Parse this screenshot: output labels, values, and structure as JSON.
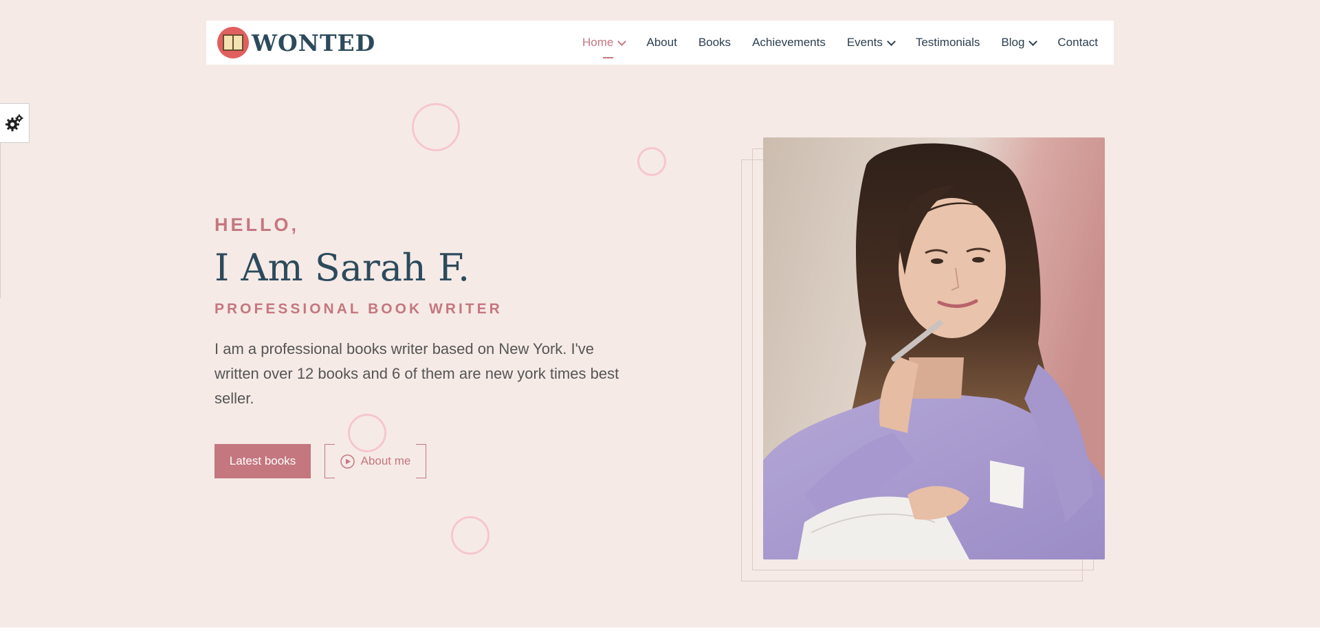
{
  "brand": {
    "name": "WONTED",
    "accent_color": "#c4777f",
    "navy_color": "#2c4a5c",
    "background_color": "#f5eae6"
  },
  "nav": {
    "items": [
      {
        "label": "Home",
        "has_dropdown": true,
        "active": true
      },
      {
        "label": "About",
        "has_dropdown": false,
        "active": false
      },
      {
        "label": "Books",
        "has_dropdown": false,
        "active": false
      },
      {
        "label": "Achievements",
        "has_dropdown": false,
        "active": false
      },
      {
        "label": "Events",
        "has_dropdown": true,
        "active": false
      },
      {
        "label": "Testimonials",
        "has_dropdown": false,
        "active": false
      },
      {
        "label": "Blog",
        "has_dropdown": true,
        "active": false
      },
      {
        "label": "Contact",
        "has_dropdown": false,
        "active": false
      }
    ]
  },
  "settings": {
    "icon": "gear-icon"
  },
  "hero": {
    "greeting": "HELLO,",
    "name": "I Am Sarah F.",
    "role": "PROFESSIONAL BOOK WRITER",
    "description": "I am a professional books writer based on New York. I've written over 12 books and 6 of them are new york times best seller.",
    "primary_button": "Latest books",
    "secondary_button": "About me",
    "secondary_icon": "play-circle-icon",
    "photo_icon": "author-portrait-photo"
  }
}
